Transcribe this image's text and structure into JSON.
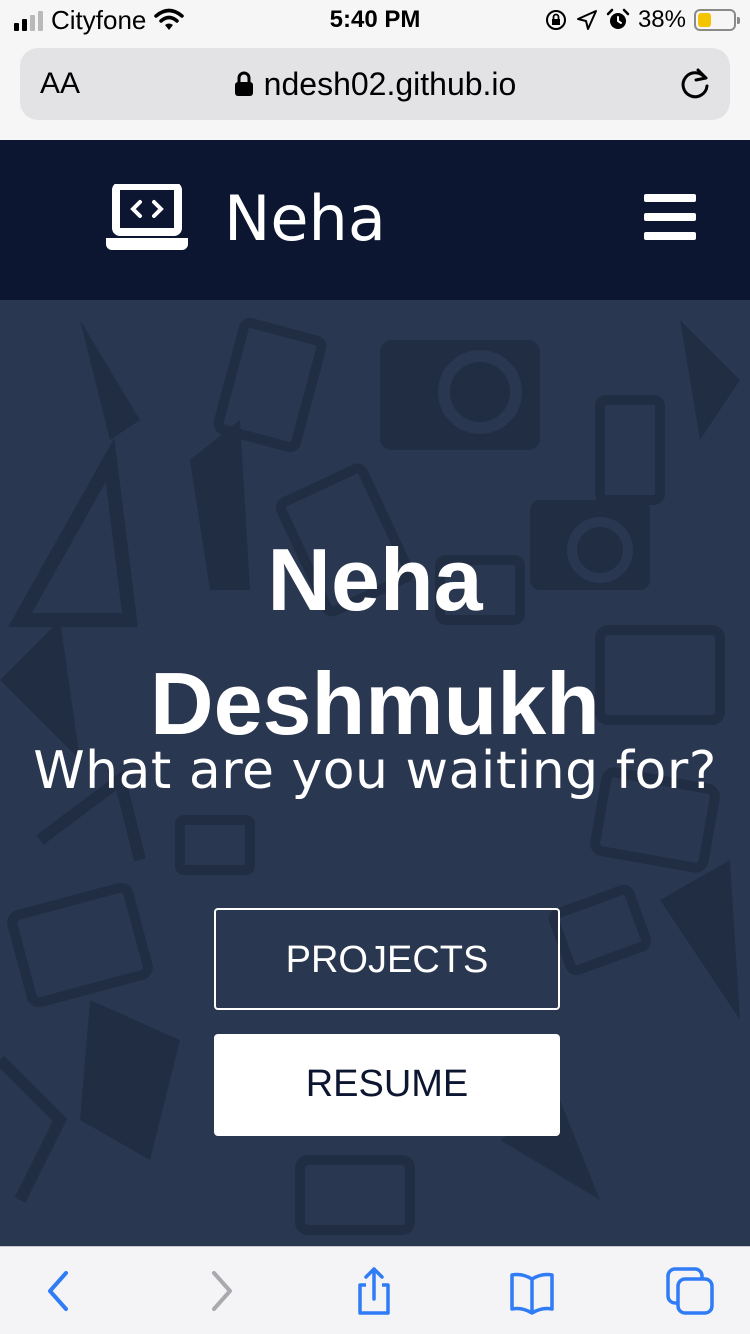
{
  "status_bar": {
    "carrier": "Cityfone",
    "time": "5:40 PM",
    "battery_percent": "38%",
    "battery_level": 0.38,
    "signal_bars_active": 2,
    "icons": [
      "signal-icon",
      "wifi-icon",
      "orientation-lock-icon",
      "location-icon",
      "alarm-icon",
      "battery-icon"
    ]
  },
  "browser": {
    "text_size_label": "AA",
    "url": "ndesh02.github.io",
    "icons": [
      "lock-icon",
      "reload-icon"
    ]
  },
  "site_nav": {
    "brand_name": "Neha",
    "icons": [
      "laptop-code-icon",
      "hamburger-menu-icon"
    ],
    "colors": {
      "background": "#0d1630",
      "text": "#ffffff"
    }
  },
  "hero": {
    "name_line1": "Neha",
    "name_line2": "Deshmukh",
    "subtitle": "What are you waiting for?",
    "buttons": {
      "projects": "PROJECTS",
      "resume": "RESUME"
    },
    "colors": {
      "background": "#2a3750",
      "pattern": "#1b2538",
      "button_text_dark": "#0d1630"
    }
  },
  "toolbar": {
    "icons": [
      "back-icon",
      "forward-icon",
      "share-icon",
      "bookmarks-icon",
      "tabs-icon"
    ],
    "colors": {
      "active": "#2f7cf6",
      "disabled": "#a9a9ae"
    }
  }
}
